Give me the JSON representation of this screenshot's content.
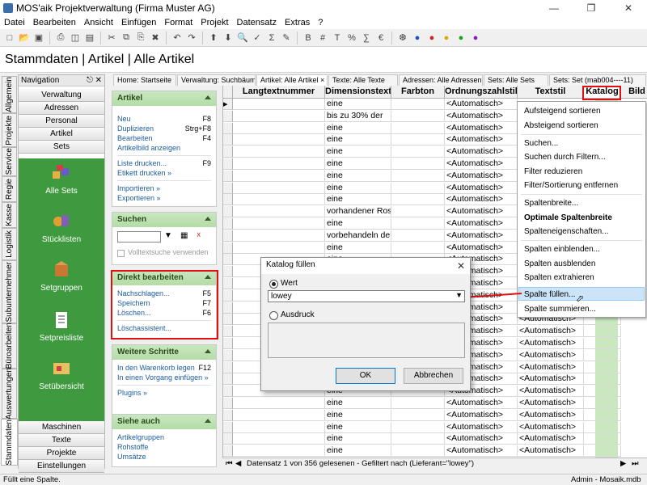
{
  "window": {
    "title": "MOS'aik Projektverwaltung (Firma Muster AG)"
  },
  "menu": [
    "Datei",
    "Bearbeiten",
    "Ansicht",
    "Einfügen",
    "Format",
    "Projekt",
    "Datensatz",
    "Extras",
    "?"
  ],
  "page_title": "Stammdaten | Artikel | Alle Artikel",
  "vtabs": [
    "Allgemein",
    "Projekte",
    "Service",
    "Regie",
    "Kasse",
    "Logistik",
    "Subunternehmer",
    "Büroarbeiten",
    "Auswertungen",
    "Stammdaten"
  ],
  "nav": {
    "header": "Navigation",
    "top_buttons": [
      "Verwaltung",
      "Adressen",
      "Personal",
      "Artikel",
      "Sets"
    ],
    "icons": [
      "Alle Sets",
      "Stücklisten",
      "Setgruppen",
      "Setpreisliste",
      "Setübersicht"
    ],
    "bottom_buttons": [
      "Maschinen",
      "Texte",
      "Projekte",
      "Einstellungen"
    ]
  },
  "panels": {
    "artikel": {
      "title": "Artikel",
      "items": [
        {
          "label": "Neu",
          "key": "F8"
        },
        {
          "label": "Duplizieren",
          "key": "Strg+F8"
        },
        {
          "label": "Bearbeiten",
          "key": "F4"
        },
        {
          "label": "Artikelbild anzeigen",
          "key": ""
        },
        {
          "label": "Liste drucken...",
          "key": "F9"
        },
        {
          "label": "Etikett drucken »",
          "key": ""
        },
        {
          "label": "Importieren »",
          "key": ""
        },
        {
          "label": "Exportieren »",
          "key": ""
        }
      ]
    },
    "suchen": {
      "title": "Suchen",
      "checkbox": "Volltextsuche verwenden"
    },
    "direkt": {
      "title": "Direkt bearbeiten",
      "items": [
        {
          "label": "Nachschlagen...",
          "key": "F5"
        },
        {
          "label": "Speichern",
          "key": "F7"
        },
        {
          "label": "Löschen...",
          "key": "F6"
        },
        {
          "label": "Löschassistent...",
          "key": ""
        }
      ]
    },
    "weitere": {
      "title": "Weitere Schritte",
      "items": [
        {
          "label": "In den Warenkorb legen",
          "key": "F12"
        },
        {
          "label": "In einen Vorgang einfügen »",
          "key": ""
        },
        {
          "label": "Plugins »",
          "key": ""
        }
      ]
    },
    "siehe": {
      "title": "Siehe auch",
      "items": [
        {
          "label": "Artikelgruppen",
          "key": ""
        },
        {
          "label": "Rohstoffe",
          "key": ""
        },
        {
          "label": "Umsätze",
          "key": ""
        }
      ]
    }
  },
  "doc_tabs": [
    "Home: Startseite",
    "Verwaltung: Suchbäume",
    "Artikel: Alle Artikel",
    "Texte: Alle Texte",
    "Adressen: Alle Adressen",
    "Sets: Alle Sets",
    "Sets: Set (mab004----11)"
  ],
  "grid": {
    "columns": [
      "Langtextnummer",
      "Dimensionstext",
      "Farbton",
      "Ordnungszahlstil",
      "Textstil",
      "Katalog",
      "Bild"
    ],
    "dim_values": [
      "eine",
      "bis zu 30% der",
      "eine",
      "eine",
      "eine",
      "eine",
      "eine",
      "eine",
      "eine",
      "vorhandener Rost",
      "eine",
      "vorbehandeln der",
      "eine",
      "eine",
      "eine",
      "eine",
      "eine",
      "eine",
      "eine",
      "eine",
      "eine",
      "eine",
      "eine",
      "eine",
      "eine",
      "eine",
      "eine",
      "eine",
      "eine",
      "eine"
    ],
    "auto": "<Automatisch>"
  },
  "grid_status": "Datensatz 1 von 356 gelesenen - Gefiltert nach (Lieferant=\"lowey\")",
  "context_menu": [
    "Aufsteigend sortieren",
    "Absteigend sortieren",
    "Suchen...",
    "Suchen durch Filtern...",
    "Filter reduzieren",
    "Filter/Sortierung entfernen",
    "Spaltenbreite...",
    "Optimale Spaltenbreite",
    "Spalteneigenschaften...",
    "Spalten einblenden...",
    "Spalten ausblenden",
    "Spalten extrahieren",
    "Spalte füllen...",
    "Spalte summieren..."
  ],
  "dialog": {
    "title": "Katalog füllen",
    "radio_value": "Wert",
    "value": "lowey",
    "radio_expr": "Ausdruck",
    "ok": "OK",
    "cancel": "Abbrechen"
  },
  "status": {
    "left": "Füllt eine Spalte.",
    "right1": "Admin - Mosaik.mdb"
  },
  "colors": {
    "green": "#3f9a3f",
    "highlight": "#e01010"
  }
}
